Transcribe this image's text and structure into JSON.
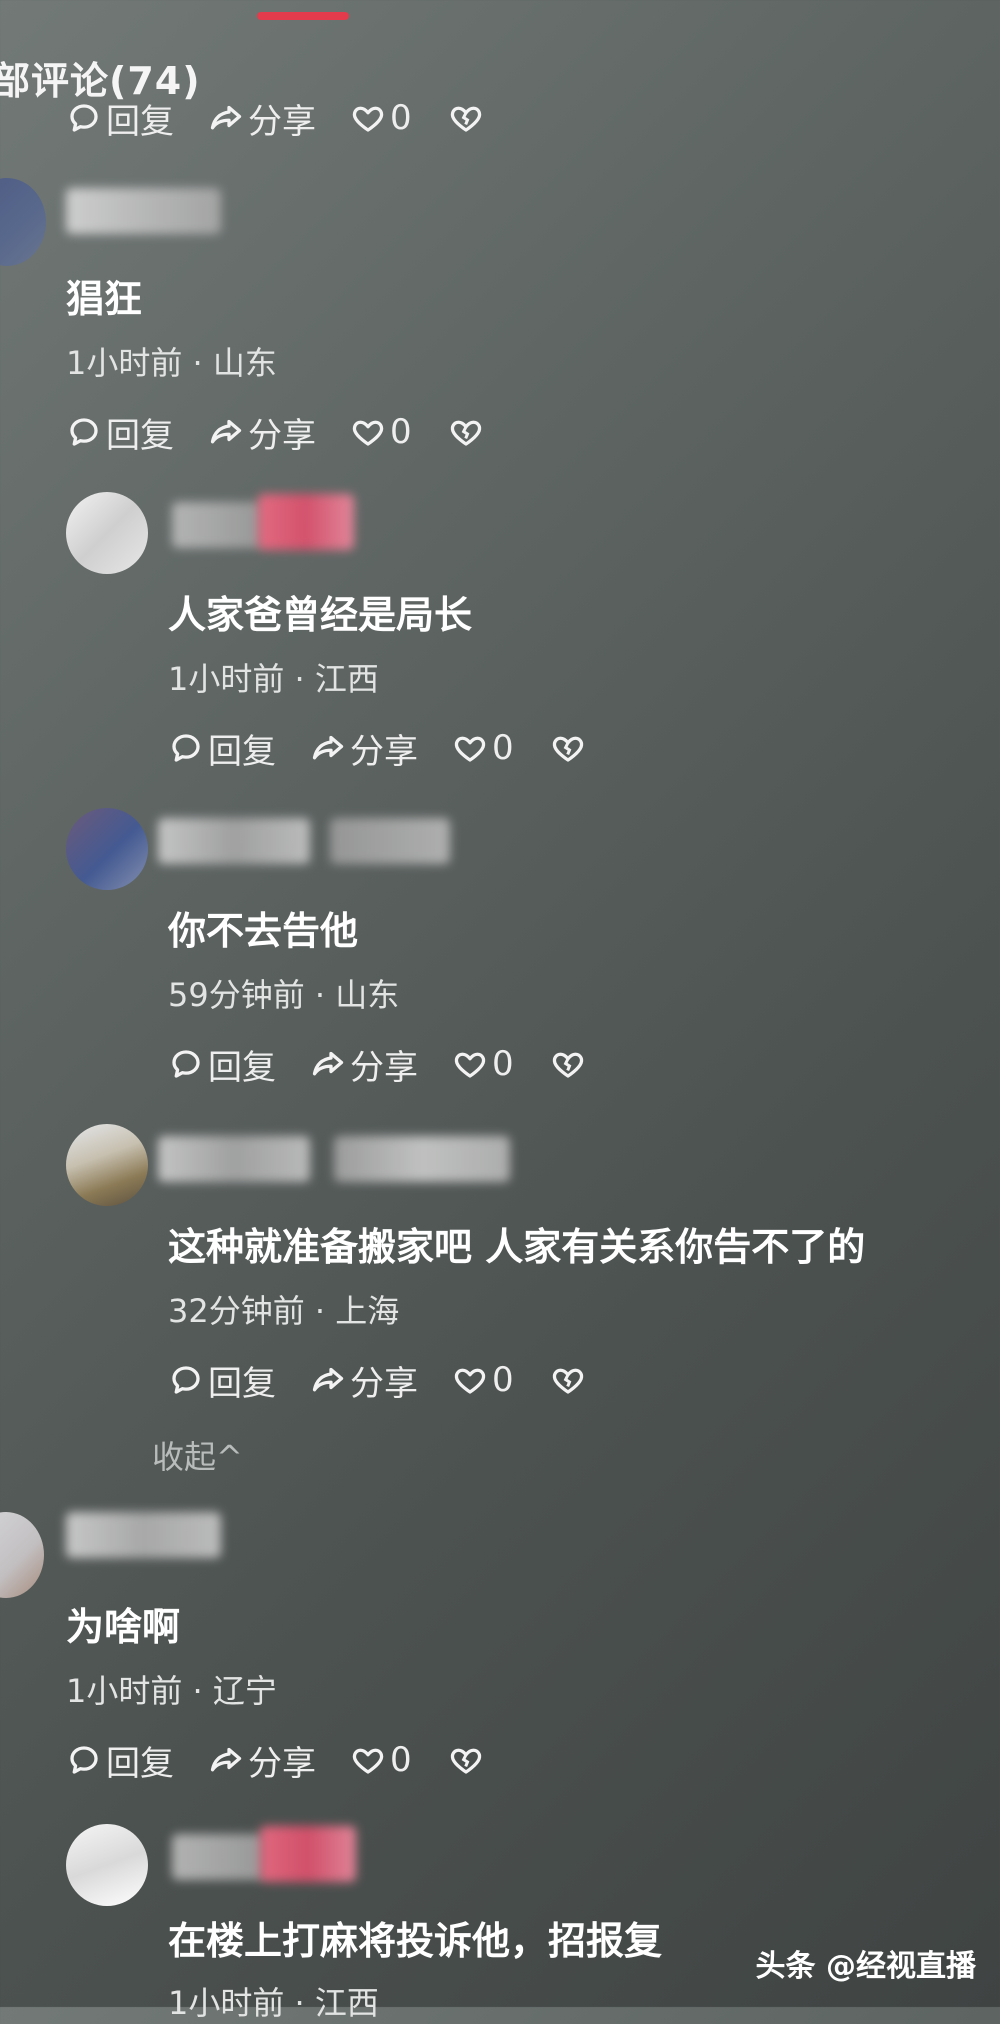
{
  "header": {
    "title": "部评论(74)"
  },
  "colors": {
    "accent": "#e33b4b"
  },
  "action_labels": {
    "reply": "回复",
    "share": "分享",
    "like_count": "0"
  },
  "icons": {
    "reply": "comment-bubble-icon",
    "share": "share-arrow-icon",
    "like": "heart-icon",
    "dislike": "broken-heart-icon"
  },
  "comments": [
    {
      "text": "猖狂",
      "time": "1小时前",
      "location": "山东",
      "likes": "0"
    },
    {
      "text": "人家爸曾经是局长",
      "time": "1小时前",
      "location": "江西",
      "likes": "0"
    },
    {
      "text": "你不去告他",
      "time": "59分钟前",
      "location": "山东",
      "likes": "0"
    },
    {
      "text": "这种就准备搬家吧 人家有关系你告不了的",
      "time": "32分钟前",
      "location": "上海",
      "likes": "0"
    },
    {
      "text": "为啥啊",
      "time": "1小时前",
      "location": "辽宁",
      "likes": "0"
    },
    {
      "text": "在楼上打麻将投诉他，招报复",
      "time": "1小时前",
      "location": "江西",
      "likes": ""
    }
  ],
  "collapse_label": "收起^",
  "watermark": "头条 @经视直播"
}
